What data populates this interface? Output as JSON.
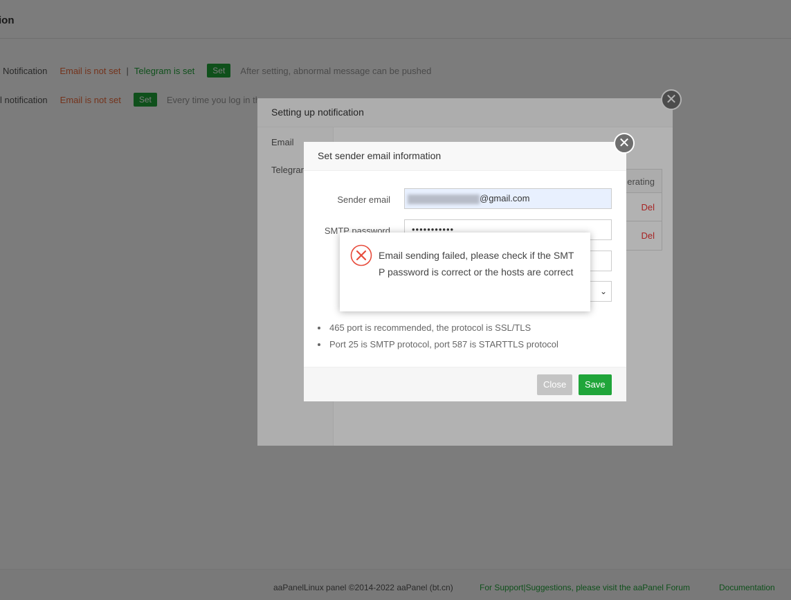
{
  "page": {
    "title": "ion",
    "rows": [
      {
        "label": "Notification",
        "email_status": "Email is not set",
        "separator": "|",
        "telegram_status": "Telegram is set",
        "set_label": "Set",
        "hint": "After setting, abnormal message can be pushed"
      },
      {
        "label": "l notification",
        "email_status": "Email is not set",
        "set_label": "Set",
        "hint": "Every time you log in th"
      }
    ]
  },
  "footer": {
    "copyright": "aaPanelLinux panel ©2014-2022 aaPanel (bt.cn)",
    "support": "For Support|Suggestions, please visit the aaPanel Forum",
    "docs": "Documentation"
  },
  "notify_modal": {
    "title": "Setting up notification",
    "tabs": [
      "Email",
      "Telegran"
    ],
    "table_header": "erating",
    "rows": [
      "Del",
      "Del"
    ],
    "close_glyph": "✕"
  },
  "email_modal": {
    "title": "Set sender email information",
    "sender_label": "Sender email",
    "sender_value": "@gmail.com",
    "smtp_label": "SMTP password",
    "smtp_value": "•••••••••••",
    "select_arrow": "⌄",
    "notes": [
      "465 port is recommended, the protocol is SSL/TLS",
      "Port 25 is SMTP protocol, port 587 is STARTTLS protocol"
    ],
    "close_label": "Close",
    "save_label": "Save",
    "close_glyph": "✕"
  },
  "error_toast": {
    "message": "Email sending failed, please check if the SMTP password is correct or the hosts are correct",
    "icon": "error-circle-x-icon",
    "color": "#e74c3c"
  }
}
